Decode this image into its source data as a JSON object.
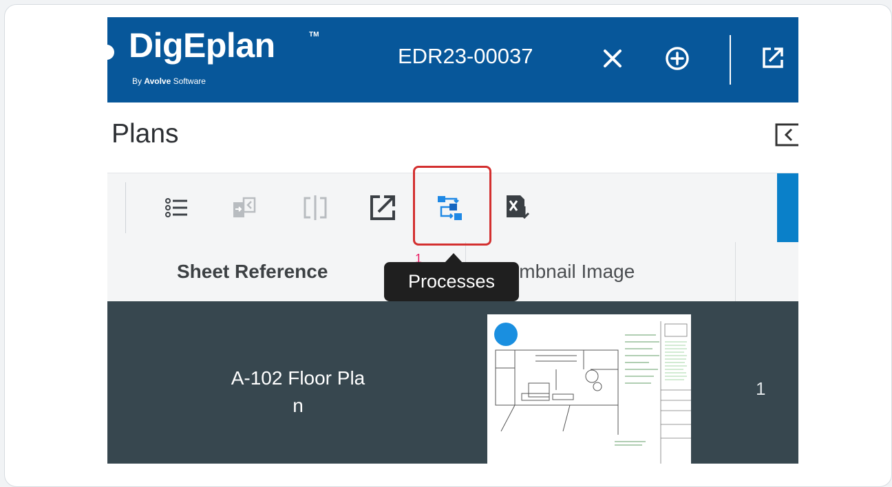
{
  "header": {
    "brand": "DigEplan",
    "trademark": "TM",
    "byline_prefix": "By ",
    "byline_company": "Avolve",
    "byline_suffix": " Software",
    "plan_id": "EDR23-00037",
    "bg_color": "#07579a"
  },
  "panel": {
    "title": "Plans"
  },
  "toolbar": {
    "icons": [
      "list-icon",
      "import-icon",
      "compare-icon",
      "open-external-icon",
      "processes-icon",
      "excel-export-icon"
    ],
    "highlight_color": "#d32f2f"
  },
  "tooltip": {
    "text": "Processes"
  },
  "table": {
    "columns": [
      "Sheet Reference",
      "Thumbnail Image"
    ],
    "sort_marker": "1",
    "rows": [
      {
        "sheet_reference_line1": "A-102 Floor Pla",
        "sheet_reference_line2": "n",
        "count": "1"
      }
    ]
  },
  "colors": {
    "accent": "#0a80c9",
    "row_bg": "#37474f",
    "dot": "#1a8fe0"
  }
}
